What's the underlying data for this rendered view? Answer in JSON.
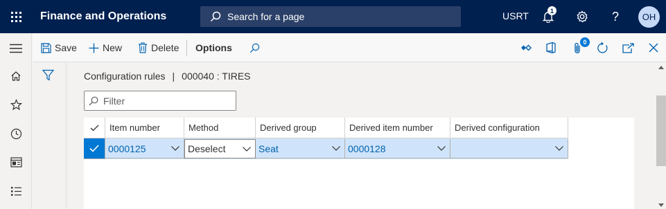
{
  "topbar": {
    "app_title": "Finance and Operations",
    "search_placeholder": "Search for a page",
    "company": "USRT",
    "notification_count": "1",
    "avatar_initials": "OH",
    "help_label": "?"
  },
  "actionpane": {
    "save_label": "Save",
    "new_label": "New",
    "delete_label": "Delete",
    "options_label": "Options",
    "attachment_count": "0"
  },
  "breadcrumb": {
    "page": "Configuration rules",
    "separator": "|",
    "record": "000040 : TIRES"
  },
  "filter": {
    "placeholder": "Filter"
  },
  "grid": {
    "columns": [
      "Item number",
      "Method",
      "Derived group",
      "Derived item number",
      "Derived configuration"
    ],
    "rows": [
      {
        "selected": true,
        "item_number": "0000125",
        "method": "Deselect",
        "derived_group": "Seat",
        "derived_item_number": "0000128",
        "derived_configuration": ""
      }
    ]
  },
  "colors": {
    "topbar": "#002050",
    "accent": "#0078d4",
    "selected_row": "#cfe4fa"
  }
}
